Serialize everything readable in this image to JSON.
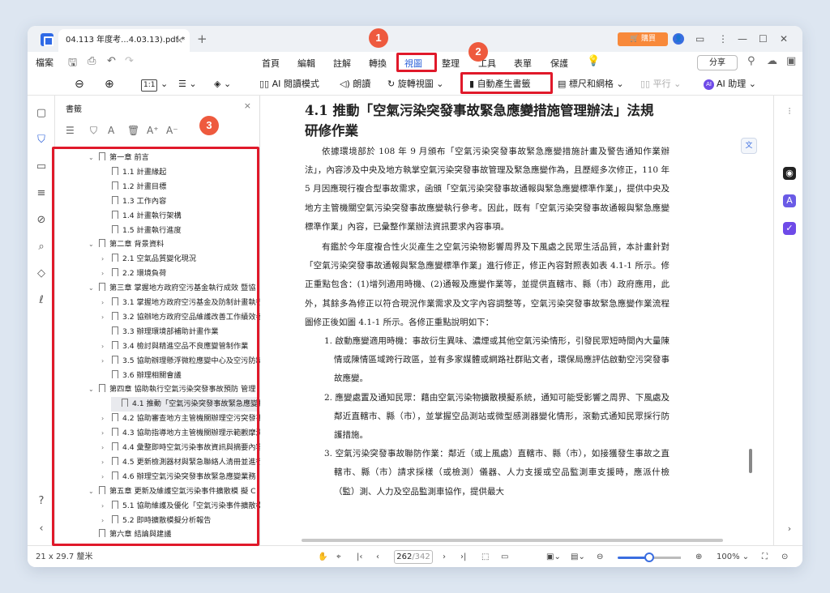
{
  "titlebar": {
    "tab_title": "04.113 年度考...4.03.13).pdf *",
    "tab_close": "×",
    "new_tab": "+",
    "buy_label": "購買"
  },
  "menubar": {
    "file": "檔案",
    "items": [
      "首頁",
      "編輯",
      "註解",
      "轉換",
      "視圖",
      "整理",
      "工具",
      "表單",
      "保護"
    ],
    "active_item": "視圖",
    "share": "分享"
  },
  "toolbar": {
    "fit_label": "1:1",
    "read_mode": "AI 閱讀模式",
    "read_aloud": "朗讀",
    "rotate": "旋轉視圖",
    "auto_bookmark": "自動產生書籤",
    "rulers": "標尺和網格",
    "compare": "平行",
    "ai_assistant": "AI 助理",
    "ai_badge": "AI"
  },
  "callouts": [
    "1",
    "2",
    "3"
  ],
  "panel": {
    "title": "書籤",
    "close": "×",
    "bookmarks": [
      {
        "label": "第一章 前言",
        "level": 0,
        "expand": "open"
      },
      {
        "label": "1.1 計畫緣起",
        "level": 1,
        "expand": "none"
      },
      {
        "label": "1.2 計畫目標",
        "level": 1,
        "expand": "none"
      },
      {
        "label": "1.3 工作內容",
        "level": 1,
        "expand": "none"
      },
      {
        "label": "1.4 計畫執行架構",
        "level": 1,
        "expand": "none"
      },
      {
        "label": "1.5 計畫執行進度",
        "level": 1,
        "expand": "none"
      },
      {
        "label": "第二章 背景資料",
        "level": 0,
        "expand": "open"
      },
      {
        "label": "2.1 空氣品質變化現況",
        "level": 1,
        "expand": "closed"
      },
      {
        "label": "2.2 環境負荷",
        "level": 1,
        "expand": "closed"
      },
      {
        "label": "第三章 掌握地方政府空污基金執行成效 暨協",
        "level": 0,
        "expand": "open"
      },
      {
        "label": "3.1 掌握地方政府空污基金及防制計畫執行",
        "level": 1,
        "expand": "closed"
      },
      {
        "label": "3.2 協辦地方政府空品維護改善工作績效考",
        "level": 1,
        "expand": "closed"
      },
      {
        "label": "3.3 辦理環境部補助計畫作業",
        "level": 1,
        "expand": "none"
      },
      {
        "label": "3.4 檢討與精進空品不良應變管制作業",
        "level": 1,
        "expand": "closed"
      },
      {
        "label": "3.5 協助辦理懸浮微粒應變中心及空污防制",
        "level": 1,
        "expand": "closed"
      },
      {
        "label": "3.6 辦理相關會議",
        "level": 1,
        "expand": "none"
      },
      {
        "label": "第四章 協助執行空氣污染突發事故預防 管理",
        "level": 0,
        "expand": "open"
      },
      {
        "label": "4.1 推動「空氣污染突發事故緊急應變措施",
        "level": 1,
        "expand": "none",
        "selected": true
      },
      {
        "label": "4.2 協助審查地方主管機關辦理空污突發事",
        "level": 1,
        "expand": "closed"
      },
      {
        "label": "4.3 協助指導地方主管機關辦理示範觀摩演",
        "level": 1,
        "expand": "closed"
      },
      {
        "label": "4.4 彙整即時空氣污染事故資訊與摘要內容",
        "level": 1,
        "expand": "closed"
      },
      {
        "label": "4.5 更新檢測器材與緊急聯絡人清冊並進行",
        "level": 1,
        "expand": "closed"
      },
      {
        "label": "4.6 辦理空氣污染突發事故緊急應變業務",
        "level": 1,
        "expand": "closed"
      },
      {
        "label": "第五章 更新及維護空氣污染事件擴散模 擬 C",
        "level": 0,
        "expand": "open"
      },
      {
        "label": "5.1 協助維護及優化「空氣污染事件擴散模",
        "level": 1,
        "expand": "closed"
      },
      {
        "label": "5.2 即時擴散模擬分析報告",
        "level": 1,
        "expand": "closed"
      },
      {
        "label": "第六章 結論與建議",
        "level": 0,
        "expand": "none"
      }
    ]
  },
  "document": {
    "heading": "4.1 推動「空氣污染突發事故緊急應變措施管理辦法」法規研修作業",
    "para1": "依據環境部於 108 年 9 月頒布「空氣污染突發事故緊急應變措施計畫及警告通知作業辦法」，內容涉及中央及地方執掌空氣污染突發事故管理及緊急應變作為，且歷經多次修正，110 年 5 月因應現行複合型事故需求，函頒「空氣污染突發事故通報與緊急應變標準作業」，提供中央及地方主管機關空氣污染突發事故應變執行參考。因此，既有「空氣污染突發事故通報與緊急應變標準作業」內容，已彙整作業辦法資訊要求內容事項。",
    "para2": "有鑑於今年度複合性火災產生之空氣污染物影響周界及下風處之民眾生活品質，本計畫針對「空氣污染突發事故通報與緊急應變標準作業」進行修正，修正內容對照表如表 4.1-1 所示。修正重點包含：(1)增列適用時機、(2)通報及應變作業等，並提供直轄市、縣（市）政府應用，此外，其餘多為修正以符合現況作業需求及文字內容調整等，空氣污染突發事故緊急應變作業流程圖修正後如圖 4.1-1 所示。各修正重點說明如下：",
    "items": [
      "1. 啟動應變適用時機：事故衍生異味、濃煙或其他空氣污染情形，引發民眾短時間內大量陳情或陳情區域跨行政區，並有多家媒體或網路社群貼文者，環保局應評估啟動空污突發事故應變。",
      "2. 應變處置及通知民眾：藉由空氣污染物擴散模擬系統，通知可能受影響之周界、下風處及鄰近直轄市、縣（市），並掌握空品測站或微型感測器變化情形，滾動式通知民眾採行防護措施。",
      "3. 空氣污染突發事故聯防作業：鄰近（或上風處）直轄市、縣（市），如接獲發生事故之直轄市、縣（市）請求採樣（或檢測）儀器、人力支援或空品監測車支援時，應派什檢（監）測、人力及空品監測車協作，提供最大"
    ]
  },
  "statusbar": {
    "page_size": "21 x 29.7 釐米",
    "current_page": "262",
    "total_pages": "/342",
    "zoom": "100%",
    "zoom_fraction": 0.5
  }
}
